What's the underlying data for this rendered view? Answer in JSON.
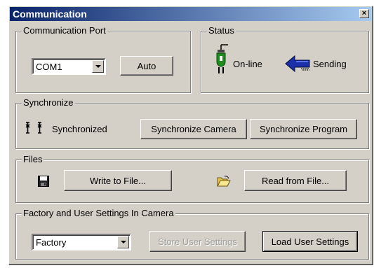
{
  "window": {
    "title": "Communication",
    "close_glyph": "×"
  },
  "port": {
    "legend": "Communication Port",
    "combo_value": "COM1",
    "auto_label": "Auto"
  },
  "status": {
    "legend": "Status",
    "online_label": "On-line",
    "sending_label": "Sending",
    "icons": [
      "plug-icon",
      "arrow-left-icon"
    ]
  },
  "sync": {
    "legend": "Synchronize",
    "status_label": "Synchronized",
    "camera_button": "Synchronize Camera",
    "program_button": "Synchronize Program",
    "icons": [
      "antenna-icon"
    ]
  },
  "files": {
    "legend": "Files",
    "write_button": "Write to File...",
    "read_button": "Read from File...",
    "icons": [
      "floppy-disk-icon",
      "folder-open-icon"
    ]
  },
  "settings": {
    "legend": "Factory and User Settings In Camera",
    "combo_value": "Factory",
    "store_button": "Store User Settings",
    "load_button": "Load User Settings"
  },
  "colors": {
    "titlebar_start": "#0a246a",
    "titlebar_end": "#a6caf0",
    "face": "#d4d0c8",
    "plug_green": "#1e8c1e",
    "arrow_blue": "#1a2fa8"
  }
}
